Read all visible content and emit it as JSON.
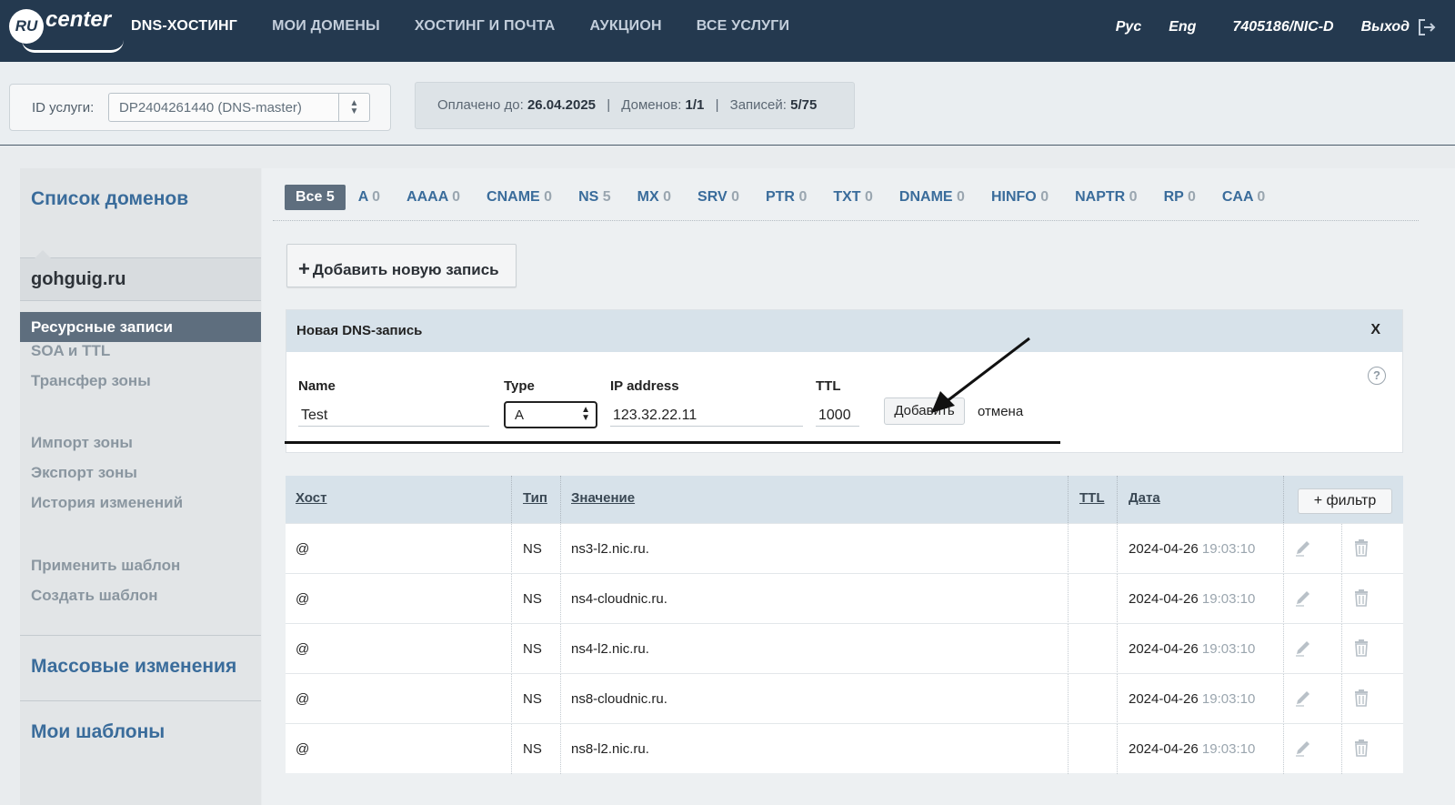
{
  "brand": {
    "badge": "RU",
    "name": "center"
  },
  "nav": {
    "items": [
      {
        "label": "DNS-ХОСТИНГ",
        "active": true
      },
      {
        "label": "МОИ ДОМЕНЫ",
        "active": false
      },
      {
        "label": "ХОСТИНГ И ПОЧТА",
        "active": false
      },
      {
        "label": "АУКЦИОН",
        "active": false
      },
      {
        "label": "ВСЕ УСЛУГИ",
        "active": false
      }
    ],
    "lang_ru": "Рус",
    "lang_en": "Eng",
    "account": "7405186/NIC-D",
    "logout": "Выход"
  },
  "service": {
    "label": "ID услуги:",
    "selected": "DP2404261440 (DNS-master)",
    "paid_label": "Оплачено до:",
    "paid_value": "26.04.2025",
    "domains_label": "Доменов:",
    "domains_value": "1/1",
    "records_label": "Записей:",
    "records_value": "5/75"
  },
  "sidebar": {
    "domain_list": "Список доменов",
    "domain": "gohguig.ru",
    "items": [
      "Ресурсные записи",
      "SOA и TTL",
      "Трансфер зоны",
      "Импорт зоны",
      "Экспорт зоны",
      "История изменений",
      "Применить шаблон",
      "Создать шаблон"
    ],
    "mass_changes": "Массовые изменения",
    "my_templates": "Мои шаблоны"
  },
  "filters": [
    {
      "label": "Все",
      "count": "5"
    },
    {
      "label": "A",
      "count": "0"
    },
    {
      "label": "AAAA",
      "count": "0"
    },
    {
      "label": "CNAME",
      "count": "0"
    },
    {
      "label": "NS",
      "count": "5"
    },
    {
      "label": "MX",
      "count": "0"
    },
    {
      "label": "SRV",
      "count": "0"
    },
    {
      "label": "PTR",
      "count": "0"
    },
    {
      "label": "TXT",
      "count": "0"
    },
    {
      "label": "DNAME",
      "count": "0"
    },
    {
      "label": "HINFO",
      "count": "0"
    },
    {
      "label": "NAPTR",
      "count": "0"
    },
    {
      "label": "RP",
      "count": "0"
    },
    {
      "label": "CAA",
      "count": "0"
    }
  ],
  "add_record": "Добавить новую запись",
  "new_record": {
    "title": "Новая DNS-запись",
    "close": "X",
    "help": "?",
    "name_label": "Name",
    "name_value": "Test",
    "type_label": "Type",
    "type_value": "A",
    "ip_label": "IP address",
    "ip_value": "123.32.22.11",
    "ttl_label": "TTL",
    "ttl_value": "1000",
    "submit": "Добавить",
    "cancel": "отмена"
  },
  "table": {
    "headers": {
      "host": "Хост",
      "type": "Тип",
      "value": "Значение",
      "ttl": "TTL",
      "date": "Дата"
    },
    "filter_button": "+ фильтр",
    "rows": [
      {
        "host": "@",
        "type": "NS",
        "value": "ns3-l2.nic.ru.",
        "ttl": "",
        "date": "2024-04-26",
        "time": "19:03:10"
      },
      {
        "host": "@",
        "type": "NS",
        "value": "ns4-cloudnic.ru.",
        "ttl": "",
        "date": "2024-04-26",
        "time": "19:03:10"
      },
      {
        "host": "@",
        "type": "NS",
        "value": "ns4-l2.nic.ru.",
        "ttl": "",
        "date": "2024-04-26",
        "time": "19:03:10"
      },
      {
        "host": "@",
        "type": "NS",
        "value": "ns8-cloudnic.ru.",
        "ttl": "",
        "date": "2024-04-26",
        "time": "19:03:10"
      },
      {
        "host": "@",
        "type": "NS",
        "value": "ns8-l2.nic.ru.",
        "ttl": "",
        "date": "2024-04-26",
        "time": "19:03:10"
      }
    ]
  }
}
